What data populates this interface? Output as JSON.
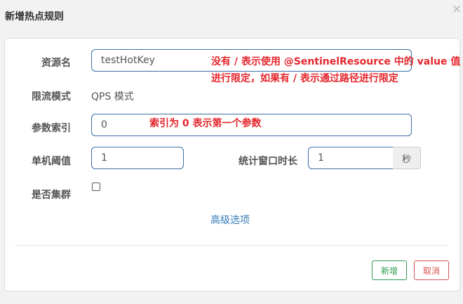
{
  "dialog": {
    "title": "新增热点规则",
    "close_glyph": "×"
  },
  "form": {
    "resource_label": "资源名",
    "resource_value": "testHotKey",
    "mode_label": "限流模式",
    "mode_value": "QPS 模式",
    "param_index_label": "参数索引",
    "param_index_value": "0",
    "threshold_label": "单机阈值",
    "threshold_value": "1",
    "window_label": "统计窗口时长",
    "window_value": "1",
    "window_unit": "秒",
    "cluster_label": "是否集群",
    "cluster_checked": false,
    "advanced_link": "高级选项"
  },
  "annotations": {
    "resource_note_line1": "没有 / 表示使用 @SentinelResource 中的 value 值",
    "resource_note_line2": "进行限定，如果有 / 表示通过路径进行限定",
    "index_note": "索引为 0 表示第一个参数"
  },
  "buttons": {
    "new_label": "新增",
    "cancel_label": "取消"
  },
  "colors": {
    "annotation": "#e5262c",
    "input_border": "#3a6ea5",
    "new_button": "#2e9a4e",
    "cancel_button": "#d9534f",
    "link": "#337ab7"
  }
}
